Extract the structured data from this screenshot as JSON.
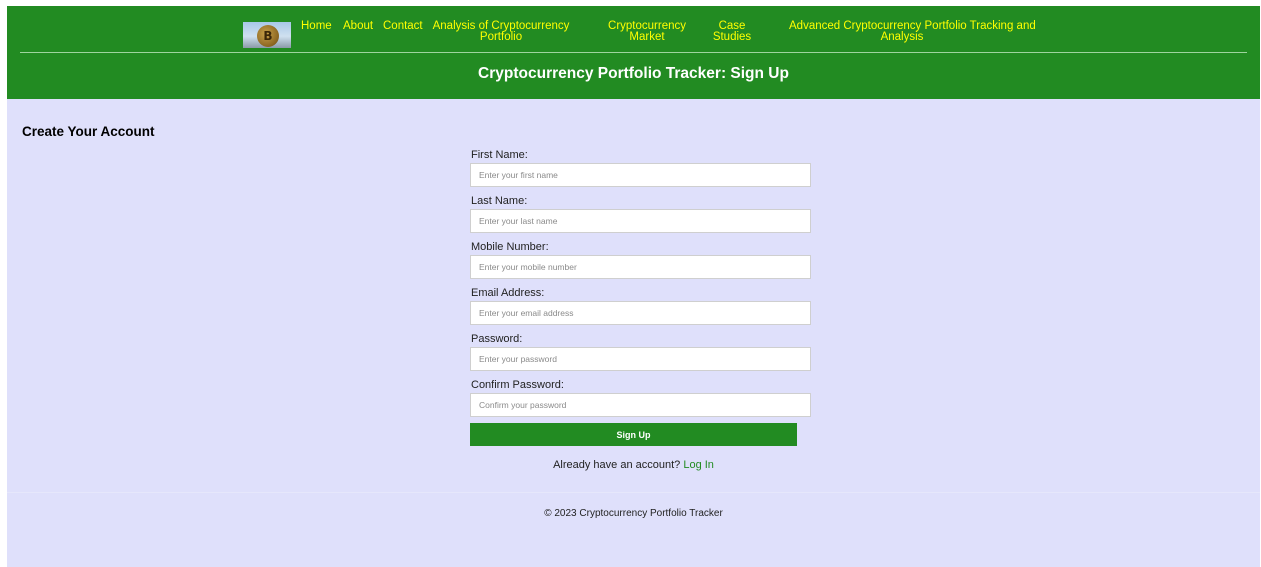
{
  "nav": {
    "logo_text": "B",
    "links": [
      {
        "lines": [
          "Home"
        ]
      },
      {
        "lines": [
          "About"
        ]
      },
      {
        "lines": [
          "Contact"
        ]
      },
      {
        "lines": [
          "Analysis of Cryptocurrency",
          "Portfolio"
        ]
      },
      {
        "lines": [
          "Cryptocurrency",
          "Market"
        ]
      },
      {
        "lines": [
          "Case",
          "Studies"
        ]
      },
      {
        "lines": [
          "Advanced Cryptocurrency Portfolio Tracking and",
          "Analysis"
        ]
      }
    ]
  },
  "header": {
    "title": "Cryptocurrency Portfolio Tracker: Sign Up"
  },
  "main": {
    "section_title": "Create Your Account"
  },
  "form": {
    "fields": [
      {
        "label": "First Name:",
        "placeholder": "Enter your first name",
        "value": ""
      },
      {
        "label": "Last Name:",
        "placeholder": "Enter your last name",
        "value": ""
      },
      {
        "label": "Mobile Number:",
        "placeholder": "Enter your mobile number",
        "value": ""
      },
      {
        "label": "Email Address:",
        "placeholder": "Enter your email address",
        "value": ""
      },
      {
        "label": "Password:",
        "placeholder": "Enter your password",
        "value": ""
      },
      {
        "label": "Confirm Password:",
        "placeholder": "Confirm your password",
        "value": ""
      }
    ],
    "submit_label": "Sign Up",
    "login_prompt": "Already have an account?",
    "login_link": "Log In"
  },
  "footer": {
    "copyright": "© 2023 Cryptocurrency Portfolio Tracker"
  },
  "colors": {
    "header_bg": "#228b22",
    "page_bg": "#dfe0fb",
    "nav_link": "#ffff00",
    "button_bg": "#228b22",
    "link": "#228b22"
  }
}
